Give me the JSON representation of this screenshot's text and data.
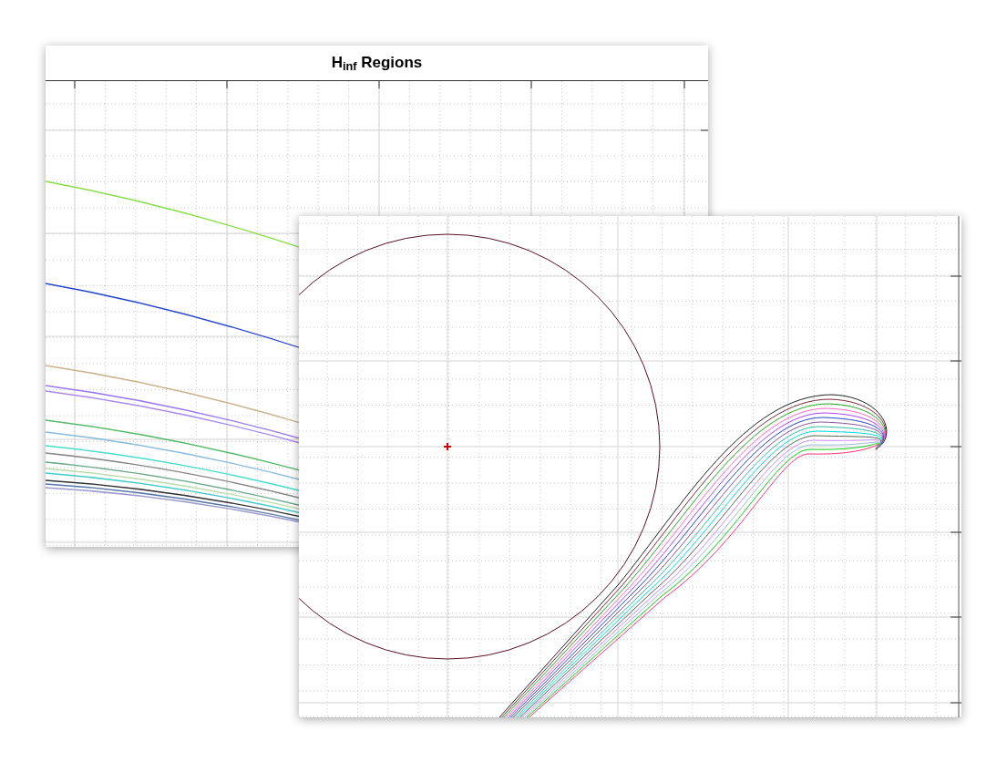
{
  "back_plot": {
    "title": "H$_{inf}$ Regions"
  }
}
